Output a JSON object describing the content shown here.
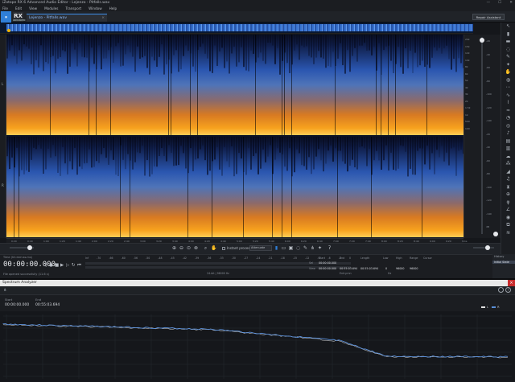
{
  "app": {
    "title": "iZotope RX 6 Advanced Audio Editor - Lejenzo - Pitfalls.wav",
    "menu": [
      "File",
      "Edit",
      "View",
      "Modules",
      "Transport",
      "Window",
      "Help"
    ],
    "logo_text": "RX",
    "logo_sub": "ADVANCED",
    "file_tab": "Lejenzo - Pitfalls.wav",
    "repair_button": "Repair Assistant",
    "window_buttons": [
      "—",
      "☐",
      "✕"
    ]
  },
  "colors": {
    "accent": "#2f7fd8",
    "spectrogram_low": "#0b1226",
    "spectrogram_mid": "#2a56b0",
    "spectrogram_high": "#f7a21e",
    "analyzer_line": "#5a8fd8"
  },
  "channels": [
    "L",
    "R"
  ],
  "freq_scale_right": [
    "20k",
    "15k",
    "12k",
    "10k",
    "8k",
    "6k",
    "5k",
    "4k",
    "3k",
    "2k",
    "1.5k",
    "1k",
    "500",
    "100"
  ],
  "db_scale": [
    "-20",
    "-40",
    "-60",
    "-80",
    "-100",
    "-120",
    "-140",
    "-20",
    "-40",
    "-60",
    "-80",
    "-100",
    "-120",
    "-140",
    "dB"
  ],
  "time_ruler": [
    "0:20",
    "0:40",
    "1:00",
    "1:20",
    "1:40",
    "2:00",
    "2:20",
    "2:40",
    "3:00",
    "3:20",
    "3:40",
    "4:00",
    "4:20",
    "4:40",
    "5:00",
    "5:20",
    "5:40",
    "6:00",
    "6:20",
    "6:40",
    "7:00",
    "7:20",
    "7:40",
    "8:00",
    "8:20",
    "8:40",
    "9:00",
    "9:20",
    "hms"
  ],
  "toolbar": {
    "instant_process": "Instant process",
    "instant_mode": "Attenuate"
  },
  "transport": {
    "label": "Time (hh:mm:ss.ms)",
    "timecode": "00:00:00.000",
    "status": "File opened successfully (11.6 s)"
  },
  "meter": {
    "scale": [
      "Inf",
      "-70",
      "-66",
      "-60",
      "-56",
      "-50",
      "-48",
      "-45",
      "-42",
      "-39",
      "-36",
      "-33",
      "-30",
      "-27",
      "-24",
      "-21",
      "-18",
      "-15",
      "-12",
      "-9",
      "-6",
      "-3",
      "0"
    ],
    "footer": "24-bit | 96000 Hz"
  },
  "selection": {
    "headers": [
      "Start",
      "End",
      "Length",
      "Low",
      "High",
      "Range",
      "Cursor"
    ],
    "sel_label": "Sel",
    "view_label": "View",
    "sel": [
      "00:00:00.000",
      "",
      ""
    ],
    "view": [
      "00:00:00.000",
      "00:55:03.694",
      "00:55:03.694",
      "0",
      "96000",
      "96000"
    ],
    "cursor_note": "Hz",
    "entry_note": "Entry.mn"
  },
  "history": {
    "title": "History",
    "item": "Initial State"
  },
  "analyzer": {
    "window_title": "Spectrum Analyzer",
    "start_label": "Start",
    "end_label": "End",
    "start": "00:00:00.000",
    "end": "00:55:03.694",
    "legend": [
      "L",
      "R"
    ]
  }
}
